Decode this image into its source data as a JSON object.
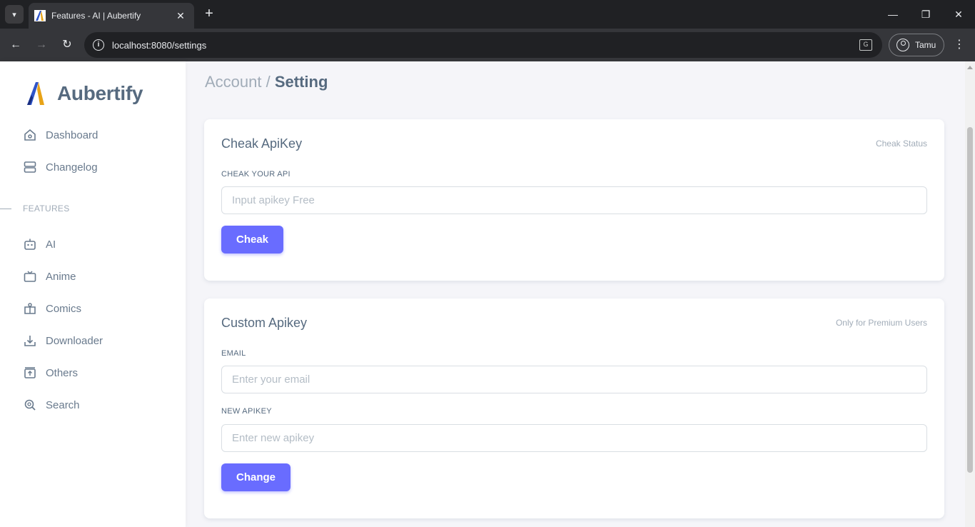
{
  "browser": {
    "tab_title": "Features - AI | Aubertify",
    "url": "localhost:8080/settings",
    "profile_name": "Tamu"
  },
  "sidebar": {
    "brand": "Aubertify",
    "top_items": [
      {
        "label": "Dashboard",
        "icon": "home-icon"
      },
      {
        "label": "Changelog",
        "icon": "server-icon"
      }
    ],
    "section_header": "FEATURES",
    "feature_items": [
      {
        "label": "AI",
        "icon": "robot-icon"
      },
      {
        "label": "Anime",
        "icon": "tv-icon"
      },
      {
        "label": "Comics",
        "icon": "book-icon"
      },
      {
        "label": "Downloader",
        "icon": "download-icon"
      },
      {
        "label": "Others",
        "icon": "upload-box-icon"
      },
      {
        "label": "Search",
        "icon": "search-icon"
      }
    ]
  },
  "breadcrumb": {
    "parent": "Account /",
    "current": "Setting"
  },
  "check_card": {
    "title": "Cheak ApiKey",
    "meta": "Cheak Status",
    "field_label": "CHEAK YOUR API",
    "input_placeholder": "Input apikey Free",
    "button_label": "Cheak"
  },
  "custom_card": {
    "title": "Custom Apikey",
    "meta": "Only for Premium Users",
    "email_label": "EMAIL",
    "email_placeholder": "Enter your email",
    "apikey_label": "NEW APIKEY",
    "apikey_placeholder": "Enter new apikey",
    "button_label": "Change"
  },
  "colors": {
    "primary": "#696cff",
    "heading": "#566a7f",
    "muted": "#a1acb8",
    "background": "#f5f5f9"
  }
}
